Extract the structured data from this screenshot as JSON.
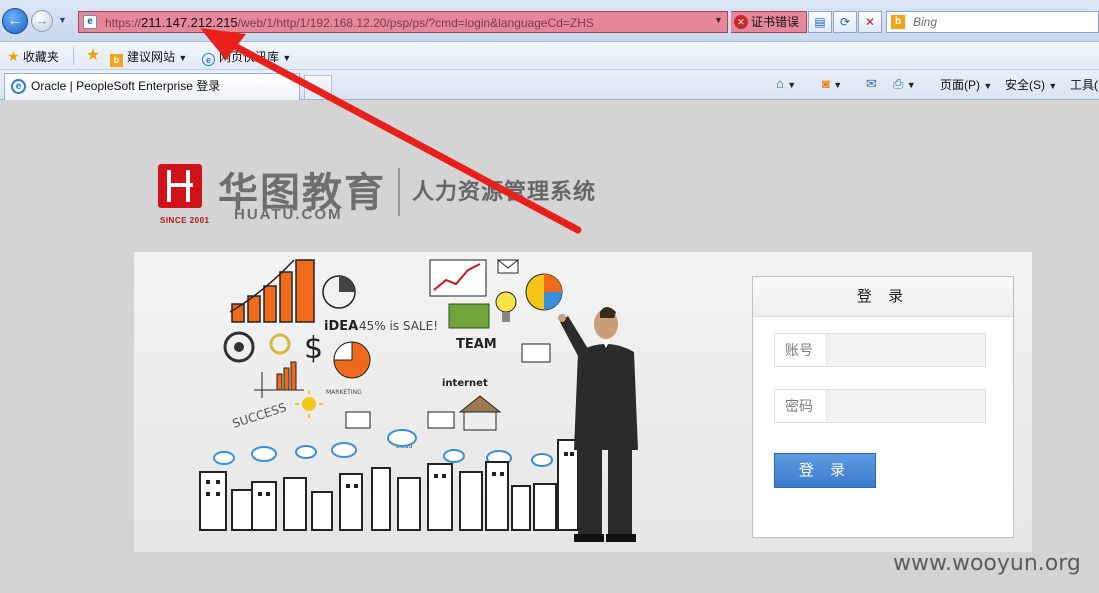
{
  "browser": {
    "url_prefix": "https://",
    "url_host": "211.147.212.215",
    "url_path": "/web/1/http/1/192.168.12.20/psp/ps/?cmd=login&languageCd=ZHS",
    "cert_error": "证书错误",
    "search_placeholder": "Bing",
    "favorites_label": "收藏夹",
    "fav_suggested": "建议网站",
    "fav_webslice": "网页快讯库",
    "tab_title": "Oracle | PeopleSoft Enterprise 登录",
    "cmd_page": "页面(P)",
    "cmd_safety": "安全(S)",
    "cmd_tools": "工具("
  },
  "brand": {
    "name_cn": "华图教育",
    "name_en": "HUATU.COM",
    "since": "SINCE 2001",
    "system_name": "人力资源管理系统"
  },
  "banner_text": {
    "idea": "iDEA",
    "sale": "45% is SALE!",
    "team": "TEAM",
    "internet": "internet",
    "success": "SUCCESS",
    "marketing": "MARKETING",
    "cloud": "cloud"
  },
  "login": {
    "title": "登 录",
    "username_label": "账号",
    "password_label": "密码",
    "submit_label": "登 录"
  },
  "watermark": "www.wooyun.org",
  "colors": {
    "accent_red": "#d0121b",
    "button_blue": "#3d7ccd",
    "cert_error_bg": "#e7889a",
    "annotation_arrow": "#e8201c"
  }
}
